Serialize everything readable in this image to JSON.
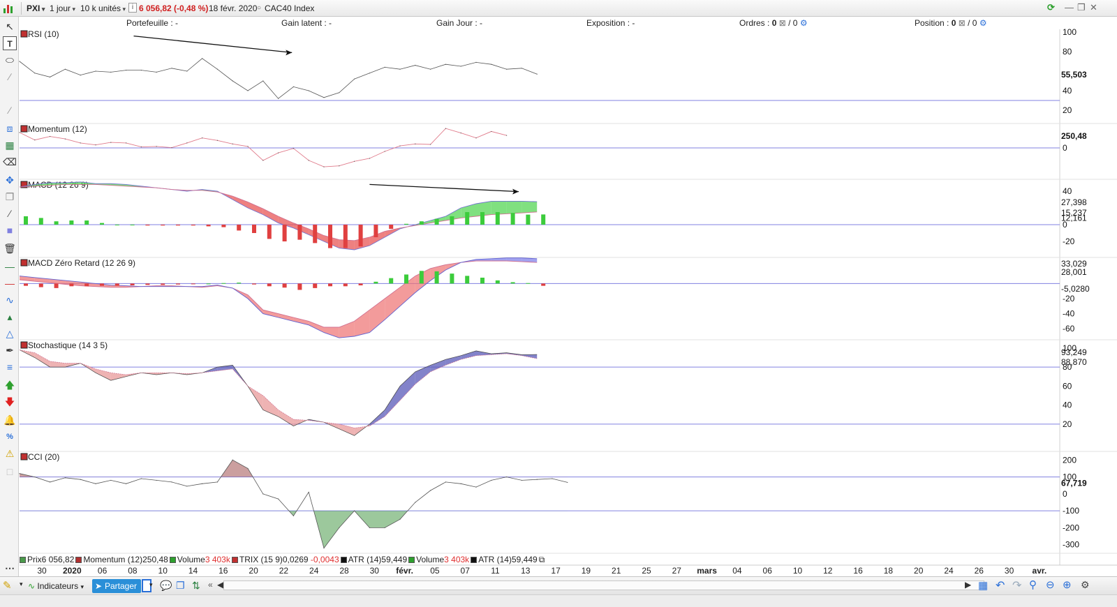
{
  "toolbar": {
    "symbol": "PXI",
    "period": "1 jour",
    "units": "10 k unités",
    "price_change": "6 056,82 (-0,48 %)",
    "date": "18 févr. 2020",
    "instrument": "CAC40 Index"
  },
  "portfolio_bar": {
    "portefeuille": "Portefeuille : -",
    "gain_latent": "Gain latent : -",
    "gain_jour": "Gain Jour : -",
    "exposition": "Exposition : -",
    "ordres_label": "Ordres :",
    "ordres_a": "0",
    "ordres_b": "/ 0",
    "position_label": "Position :",
    "position_a": "0",
    "position_b": "/ 0"
  },
  "legend": {
    "items": [
      {
        "name": "Prix",
        "value": "6 056,82",
        "color": "#4a9a4a"
      },
      {
        "name": "Momentum (12)",
        "value": "250,48",
        "color": "#b03030"
      },
      {
        "name": "Volume",
        "value": "3 403k",
        "value_neg": true,
        "color": "#2ea02e"
      },
      {
        "name": "TRIX (15 9)",
        "value": "0,0269",
        "value2": "-0,0043",
        "color": "#c03030"
      },
      {
        "name": "ATR (14)",
        "value": "59,449",
        "color": "#111111"
      },
      {
        "name": "Volume",
        "value": "3 403k",
        "value_neg": true,
        "color": "#2ea02e"
      },
      {
        "name": "ATR (14)",
        "value": "59,449",
        "color": "#111111"
      }
    ]
  },
  "bottombar": {
    "indicators_label": "Indicateurs",
    "share_label": "Partager"
  },
  "colors": {
    "pos_fill": "#55d655",
    "neg_fill": "#e85555",
    "blue_fill": "#6060d8",
    "pink_fill": "#f0b0b0",
    "refline": "#8080e0"
  },
  "chart_data": {
    "type": "line",
    "x_axis": {
      "tick_labels": [
        "30",
        "2020",
        "06",
        "08",
        "10",
        "14",
        "16",
        "20",
        "22",
        "24",
        "28",
        "30",
        "févr.",
        "05",
        "07",
        "11",
        "13",
        "17",
        "19",
        "21",
        "25",
        "27",
        "mars",
        "04",
        "06",
        "10",
        "12",
        "16",
        "18",
        "20",
        "24",
        "26",
        "30",
        "avr."
      ],
      "bold_labels": [
        "2020",
        "févr.",
        "mars",
        "avr."
      ]
    },
    "panels": [
      {
        "id": "rsi",
        "title": "RSI (10)",
        "ylim": [
          10,
          100
        ],
        "yticks": [
          "100",
          "80",
          "40",
          "20"
        ],
        "ytick_values": [
          100,
          80,
          40,
          20
        ],
        "reflines": [
          30
        ],
        "last_value": "55,503",
        "series": [
          {
            "values": [
              70,
              58,
              54,
              62,
              56,
              60,
              59,
              61,
              61,
              59,
              63,
              60,
              73,
              62,
              50,
              40,
              50,
              32,
              44,
              40,
              33,
              38,
              52,
              58,
              64,
              62,
              66,
              62,
              67,
              65,
              69,
              67,
              62,
              63,
              57
            ]
          }
        ],
        "trend_arrow": {
          "from": [
            7.5,
            96
          ],
          "to": [
            17.9,
            79
          ]
        }
      },
      {
        "id": "momentum",
        "title": "Momentum (12)",
        "ylim": [
          -560,
          420
        ],
        "yticks": [
          "0"
        ],
        "ytick_values": [
          0
        ],
        "reflines": [
          0
        ],
        "last_value": "250,48",
        "series": [
          {
            "values": [
              310,
              160,
              230,
              180,
              100,
              60,
              110,
              100,
              20,
              30,
              5,
              100,
              200,
              150,
              80,
              30,
              -250,
              -100,
              -10,
              -250,
              -380,
              -360,
              -270,
              -210,
              -70,
              40,
              80,
              70,
              390,
              300,
              200,
              330,
              250
            ]
          }
        ]
      },
      {
        "id": "macd",
        "title": "MACD (12 26 9)",
        "ylim": [
          -35,
          50
        ],
        "yticks": [
          "40",
          "0",
          "-20"
        ],
        "ytick_values": [
          40,
          0,
          -20
        ],
        "reflines": [
          0
        ],
        "last_values": [
          "27,398",
          "15,237",
          "12,161"
        ],
        "macd": [
          45,
          48,
          50,
          50,
          51,
          49,
          49,
          48,
          46,
          44,
          42,
          40,
          42,
          40,
          30,
          20,
          12,
          2,
          -4,
          -12,
          -20,
          -28,
          -30,
          -25,
          -15,
          -5,
          0,
          5,
          10,
          20,
          25,
          28,
          28,
          28,
          27.4
        ],
        "signal": [
          45,
          46,
          47,
          48,
          48,
          48,
          47,
          46,
          45,
          44,
          42,
          41,
          41,
          39,
          34,
          27,
          19,
          10,
          2,
          -5,
          -13,
          -18,
          -19,
          -15,
          -8,
          -4,
          -1,
          2,
          5,
          8,
          10,
          12,
          13,
          14,
          15.2
        ],
        "histogram": [
          10,
          8,
          4,
          5,
          5,
          2,
          0,
          0,
          -1,
          -1,
          -1,
          -1,
          -2,
          -3,
          -7,
          -10,
          -17,
          -20,
          -18,
          -22,
          -28,
          -28,
          -26,
          -15,
          -5,
          1,
          4,
          7,
          10,
          15,
          15,
          15,
          14,
          12,
          12.2
        ]
      },
      {
        "id": "macd_zero_lag",
        "title": "MACD Zéro Retard (12 26 9)",
        "ylim": [
          -70,
          30
        ],
        "yticks": [
          "-20",
          "-40",
          "-60"
        ],
        "ytick_values": [
          -20,
          -40,
          -60
        ],
        "reflines": [
          0
        ],
        "last_values": [
          "33,029",
          "28,001",
          "-5,0280"
        ],
        "line_a": [
          5,
          3,
          1,
          -1,
          -3,
          -4,
          -5,
          -5,
          -4,
          -3,
          -3,
          -4,
          -5,
          -3,
          -6,
          -15,
          -35,
          -40,
          -45,
          -50,
          -58,
          -58,
          -50,
          -35,
          -20,
          -5,
          10,
          20,
          25,
          28,
          30,
          30,
          30,
          29,
          28
        ],
        "line_b": [
          10,
          8,
          6,
          4,
          2,
          0,
          -2,
          -3,
          -4,
          -4,
          -4,
          -4,
          -4,
          -2,
          -6,
          -20,
          -40,
          -45,
          -50,
          -55,
          -65,
          -72,
          -70,
          -65,
          -48,
          -30,
          -12,
          4,
          18,
          28,
          32,
          33,
          34,
          34,
          33
        ],
        "histogram": [
          -5,
          -8,
          -10,
          -6,
          -6,
          -5,
          -5,
          -4,
          -3,
          -3,
          -2,
          -1,
          0,
          1,
          2,
          -2,
          -6,
          -9,
          -14,
          -10,
          -6,
          -6,
          -4,
          4,
          12,
          20,
          28,
          27,
          22,
          17,
          13,
          7,
          3,
          1,
          -5
        ]
      },
      {
        "id": "stochastic",
        "title": "Stochastique (14 3 5)",
        "ylim": [
          -5,
          105
        ],
        "yticks": [
          "100",
          "80",
          "60",
          "40",
          "20"
        ],
        "ytick_values": [
          100,
          80,
          60,
          40,
          20
        ],
        "reflines": [
          80,
          20
        ],
        "last_values": [
          "93,249",
          "88,870"
        ],
        "k": [
          98,
          90,
          80,
          80,
          84,
          74,
          66,
          70,
          74,
          72,
          74,
          72,
          74,
          80,
          82,
          60,
          35,
          28,
          18,
          25,
          22,
          15,
          8,
          20,
          35,
          60,
          75,
          82,
          88,
          92,
          97,
          94,
          95,
          93,
          93.2
        ],
        "d": [
          98,
          95,
          86,
          84,
          84,
          78,
          74,
          72,
          74,
          74,
          74,
          73,
          74,
          76,
          78,
          60,
          50,
          35,
          25,
          24,
          22,
          20,
          16,
          18,
          28,
          45,
          62,
          75,
          82,
          88,
          92,
          93,
          94,
          92,
          88.9
        ]
      },
      {
        "id": "cci",
        "title": "CCI (20)",
        "ylim": [
          -330,
          230
        ],
        "yticks": [
          "200",
          "100",
          "0",
          "-100",
          "-200",
          "-300"
        ],
        "ytick_values": [
          200,
          100,
          0,
          -100,
          -200,
          -300
        ],
        "reflines": [
          100,
          -100
        ],
        "last_value": "67,719",
        "series": [
          {
            "values": [
              120,
              100,
              70,
              95,
              85,
              60,
              80,
              60,
              90,
              80,
              70,
              45,
              60,
              70,
              200,
              150,
              0,
              -30,
              -130,
              10,
              -320,
              -200,
              -100,
              -200,
              -200,
              -150,
              -50,
              20,
              70,
              60,
              40,
              80,
              100,
              80,
              85,
              90,
              67.7
            ]
          }
        ]
      }
    ]
  }
}
